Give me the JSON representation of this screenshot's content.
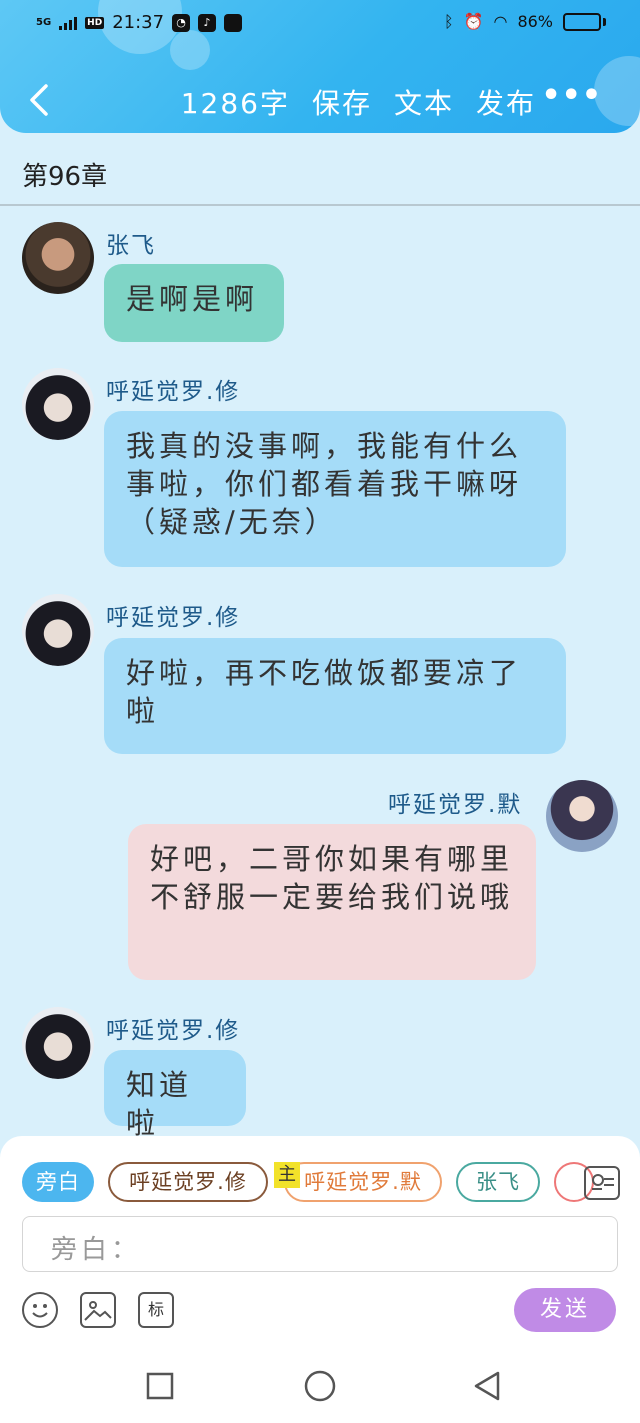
{
  "status": {
    "network": "5G",
    "hd": "HD",
    "time": "21:37",
    "battery": "86%",
    "battery_level": 0.86
  },
  "toolbar": {
    "word_count": "1286字",
    "save": "保存",
    "text": "文本",
    "publish": "发布",
    "more": "•••"
  },
  "chapter": {
    "title": "第96章"
  },
  "messages": [
    {
      "name": "张飞",
      "text": "是啊是啊"
    },
    {
      "name": "呼延觉罗.修",
      "text": "我真的没事啊，我能有什么事啦，你们都看着我干嘛呀（疑惑/无奈）"
    },
    {
      "name": "呼延觉罗.修",
      "text": "好啦，再不吃做饭都要凉了啦"
    },
    {
      "name": "呼延觉罗.默",
      "text": "好吧，二哥你如果有哪里不舒服一定要给我们说哦"
    },
    {
      "name": "呼延觉罗.修",
      "text": "知道啦"
    }
  ],
  "characters": {
    "narrator": "旁白",
    "char1": "呼延觉罗.修",
    "main_tag": "主",
    "char2": "呼延觉罗.默",
    "char3": "张飞"
  },
  "input": {
    "placeholder": "旁白："
  },
  "tools": {
    "mark": "标"
  },
  "send": "发送",
  "colors": {
    "header": "#33b4f0",
    "background": "#d9f0fb",
    "bubble_green": "#7fd5c6",
    "bubble_blue": "#a5dcf8",
    "bubble_pink": "#f3dadc",
    "send": "#c08be6"
  }
}
